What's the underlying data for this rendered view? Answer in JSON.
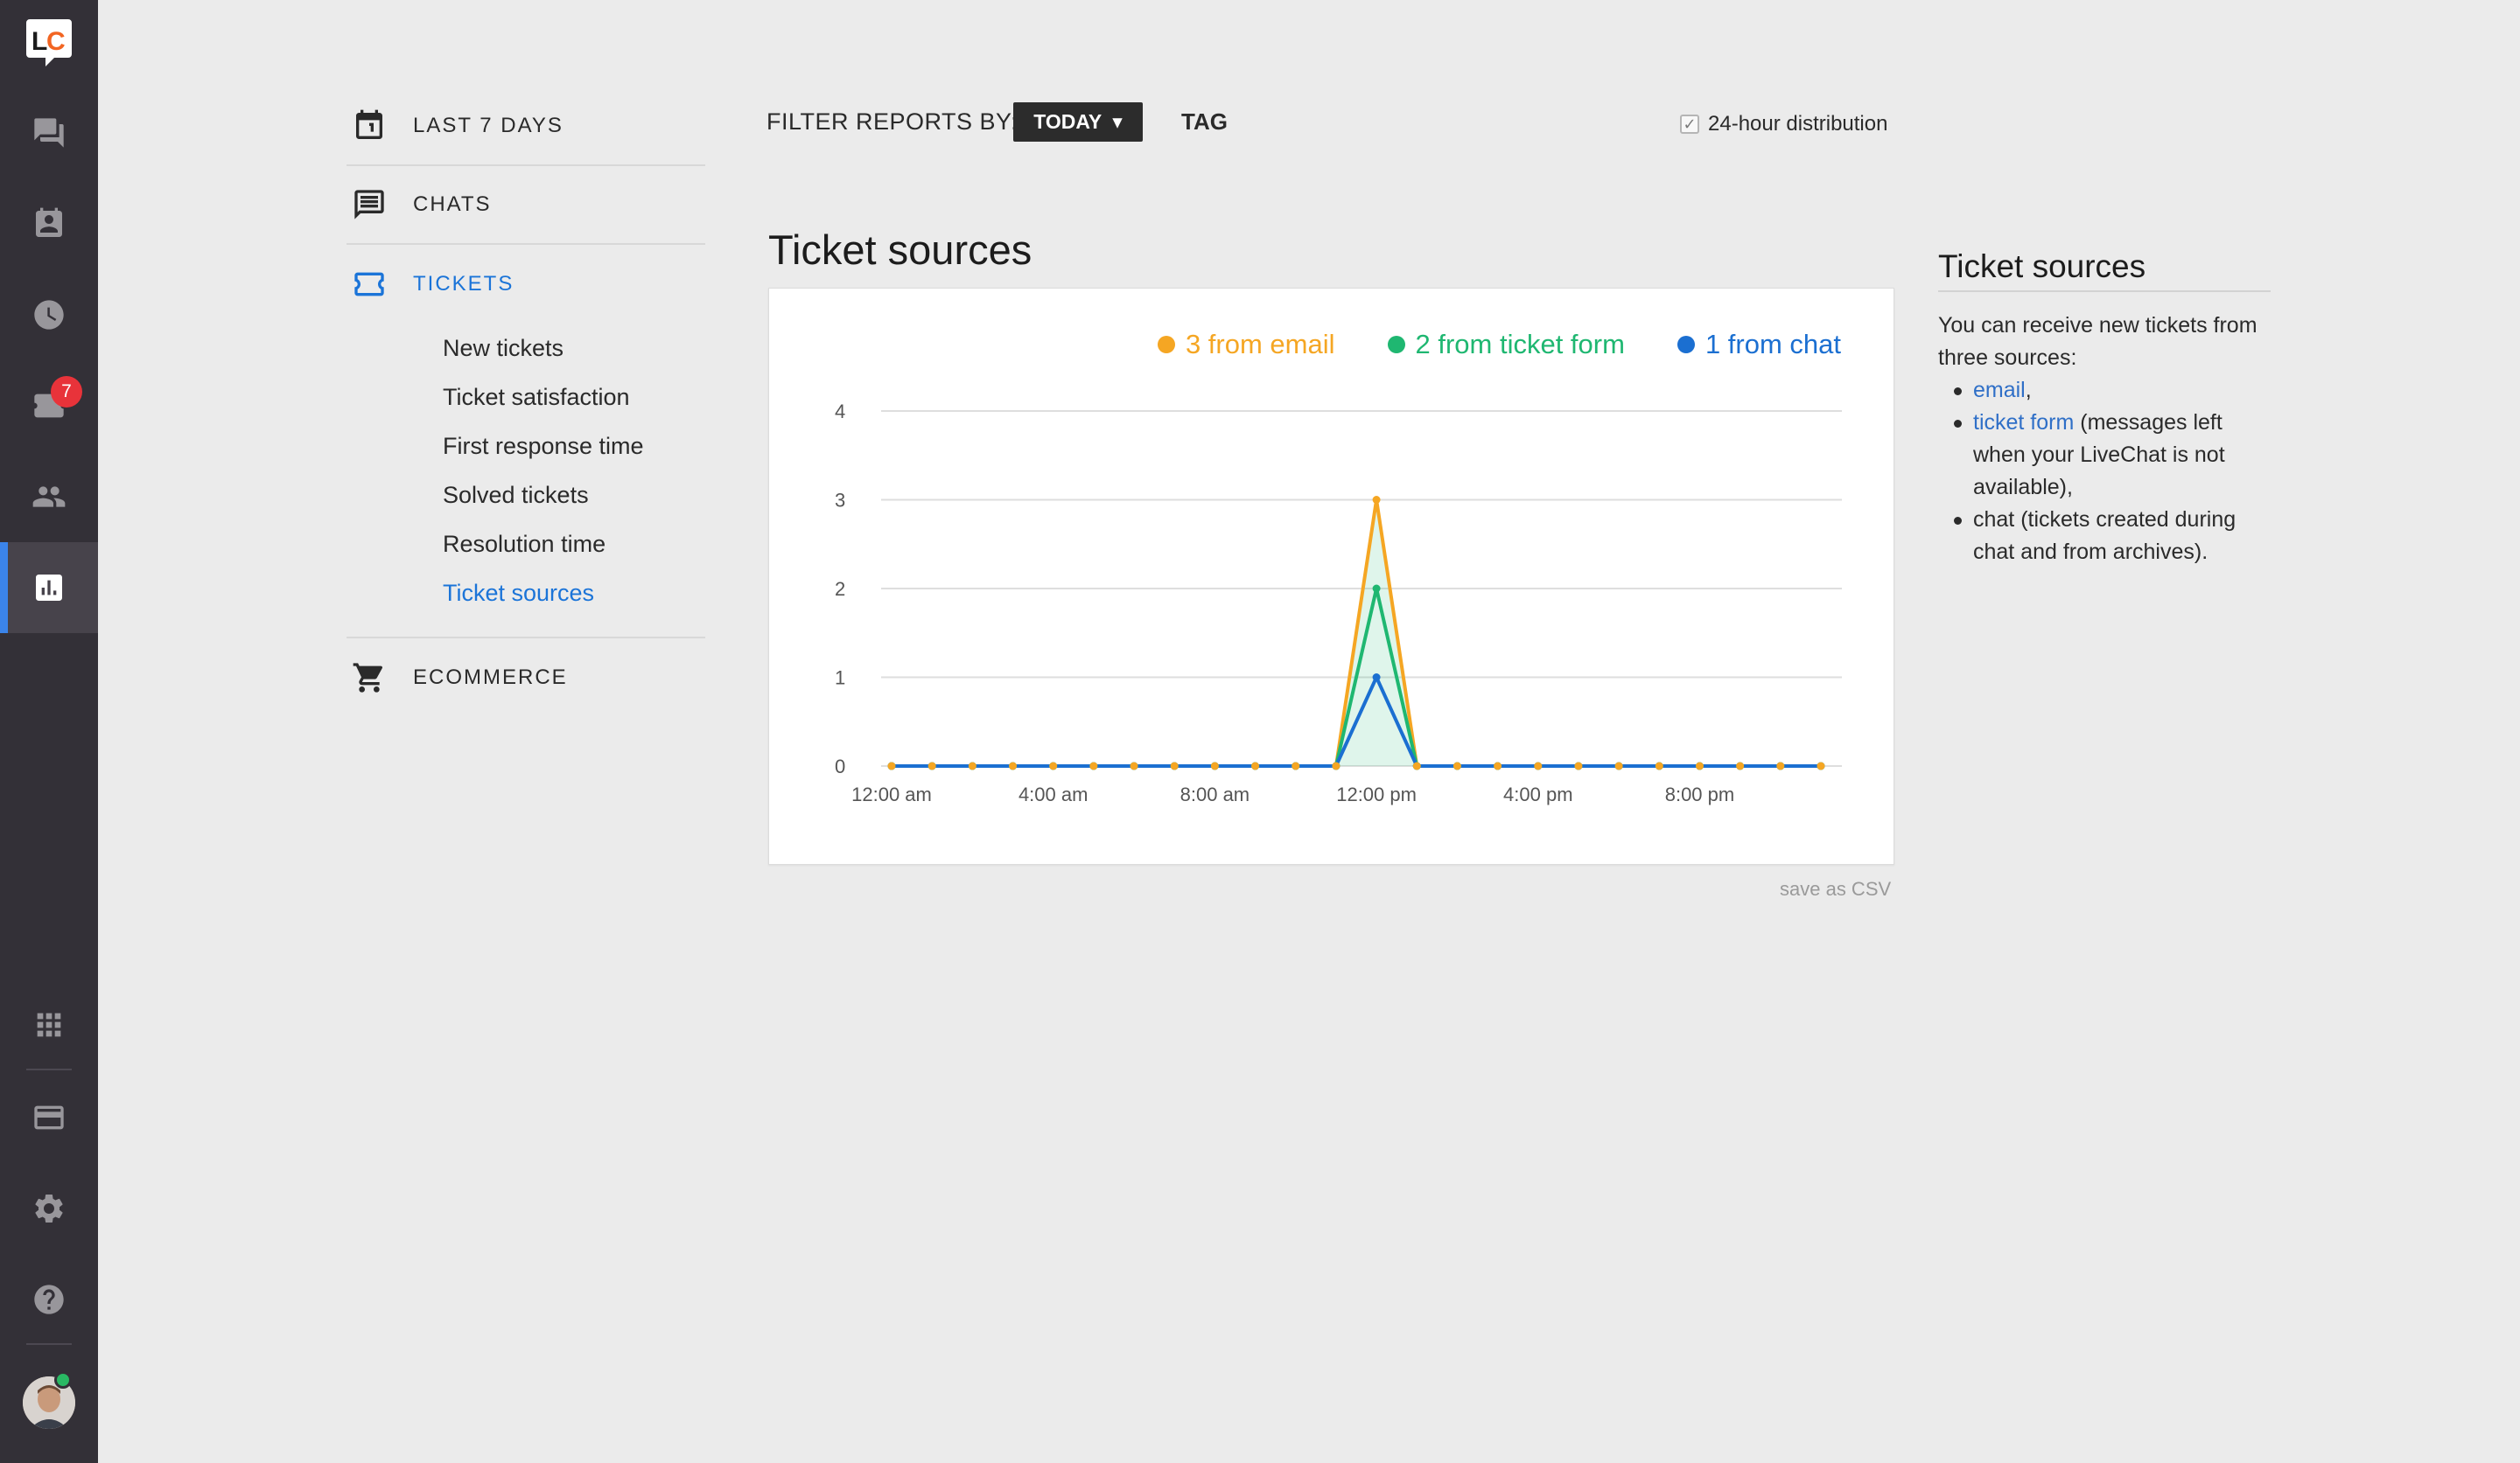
{
  "rail": {
    "logo_text": "LC",
    "items": [
      {
        "name": "chats",
        "icon": "chat-bubbles-icon"
      },
      {
        "name": "customers",
        "icon": "contact-card-icon"
      },
      {
        "name": "history",
        "icon": "clock-icon"
      },
      {
        "name": "tickets",
        "icon": "ticket-icon",
        "badge": "7"
      },
      {
        "name": "agents",
        "icon": "people-icon"
      },
      {
        "name": "reports",
        "icon": "bar-chart-icon",
        "active": true
      },
      {
        "name": "apps",
        "icon": "grid-icon"
      },
      {
        "name": "billing",
        "icon": "credit-card-icon"
      },
      {
        "name": "settings",
        "icon": "gear-icon"
      },
      {
        "name": "help",
        "icon": "question-icon"
      }
    ],
    "status_color": "#29b863"
  },
  "subnav": {
    "sections": [
      {
        "label": "LAST 7 DAYS",
        "icon": "calendar-icon"
      },
      {
        "label": "CHATS",
        "icon": "message-icon"
      },
      {
        "label": "TICKETS",
        "icon": "ticket-icon",
        "active": true
      },
      {
        "label": "ECOMMERCE",
        "icon": "cart-icon"
      }
    ],
    "ticket_items": [
      {
        "label": "New tickets"
      },
      {
        "label": "Ticket satisfaction"
      },
      {
        "label": "First response time"
      },
      {
        "label": "Solved tickets"
      },
      {
        "label": "Resolution time"
      },
      {
        "label": "Ticket sources",
        "active": true
      }
    ]
  },
  "filter": {
    "label": "FILTER REPORTS BY:",
    "period": "TODAY",
    "period_caret": "▾",
    "tag": "TAG",
    "distribution_label": "24-hour distribution",
    "distribution_checked": true,
    "check_mark": "✓"
  },
  "report": {
    "title": "Ticket sources",
    "save_csv": "save as CSV"
  },
  "chart_data": {
    "type": "line",
    "title": "",
    "legend_placement": "top-right",
    "legend": [
      {
        "label": "3 from email",
        "color": "#f5a623"
      },
      {
        "label": "2 from ticket form",
        "color": "#1fb771"
      },
      {
        "label": "1 from chat",
        "color": "#1b6fd1"
      }
    ],
    "ylim": [
      0,
      4
    ],
    "yticks": [
      "0",
      "1",
      "2",
      "3",
      "4"
    ],
    "x": [
      0,
      1,
      2,
      3,
      4,
      5,
      6,
      7,
      8,
      9,
      10,
      11,
      12,
      13,
      14,
      15,
      16,
      17,
      18,
      19,
      20,
      21,
      22,
      23
    ],
    "xticks": [
      {
        "hour": 0,
        "label": "12:00 am"
      },
      {
        "hour": 4,
        "label": "4:00 am"
      },
      {
        "hour": 8,
        "label": "8:00 am"
      },
      {
        "hour": 12,
        "label": "12:00 pm"
      },
      {
        "hour": 16,
        "label": "4:00 pm"
      },
      {
        "hour": 20,
        "label": "8:00 pm"
      }
    ],
    "grid": true,
    "series": [
      {
        "name": "email",
        "color": "#f5a623",
        "values": [
          0,
          0,
          0,
          0,
          0,
          0,
          0,
          0,
          0,
          0,
          0,
          0,
          3,
          0,
          0,
          0,
          0,
          0,
          0,
          0,
          0,
          0,
          0,
          0
        ]
      },
      {
        "name": "ticket form",
        "color": "#1fb771",
        "values": [
          0,
          0,
          0,
          0,
          0,
          0,
          0,
          0,
          0,
          0,
          0,
          0,
          2,
          0,
          0,
          0,
          0,
          0,
          0,
          0,
          0,
          0,
          0,
          0
        ]
      },
      {
        "name": "chat",
        "color": "#1b6fd1",
        "values": [
          0,
          0,
          0,
          0,
          0,
          0,
          0,
          0,
          0,
          0,
          0,
          0,
          1,
          0,
          0,
          0,
          0,
          0,
          0,
          0,
          0,
          0,
          0,
          0
        ]
      }
    ]
  },
  "help": {
    "title": "Ticket sources",
    "intro": "You can receive new tickets from three sources:",
    "items": [
      {
        "link": "email",
        "text": ","
      },
      {
        "link": "ticket form",
        "text": " (messages left when your LiveChat is not available),"
      },
      {
        "link": "",
        "text": "chat (tickets created during chat and from archives)."
      }
    ]
  }
}
